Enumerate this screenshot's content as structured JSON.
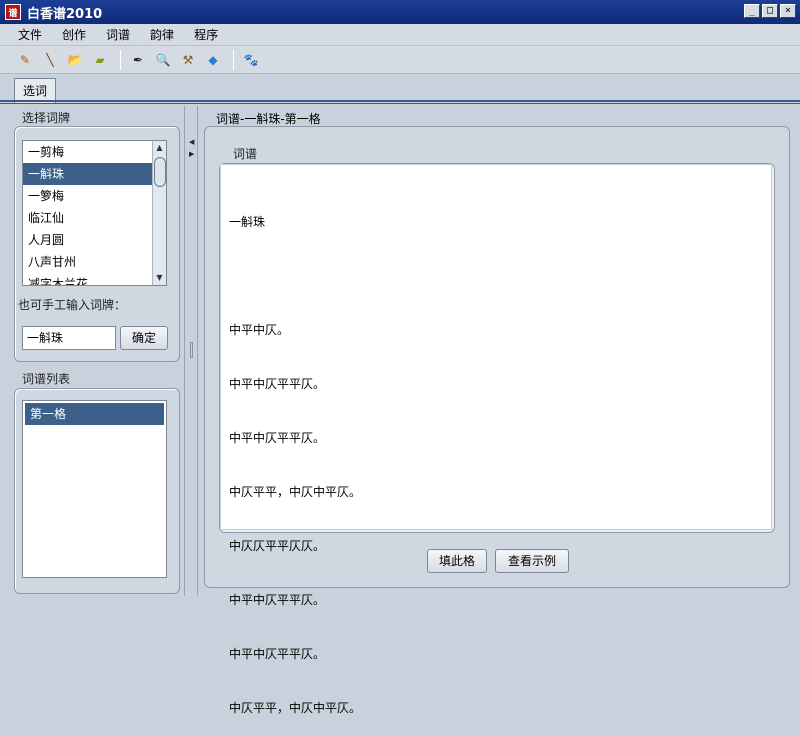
{
  "window": {
    "title": "白香谱2010",
    "app_icon_glyph": "谱",
    "controls": {
      "minimize": "_",
      "maximize": "□",
      "close": "×"
    }
  },
  "menu": [
    "文件",
    "创作",
    "词谱",
    "韵律",
    "程序"
  ],
  "toolbar": {
    "icons": [
      "pencil-icon",
      "brush-icon",
      "open-folder-icon",
      "eraser-icon",
      "pen-nib-icon",
      "magnifier-icon",
      "tools-icon",
      "tag-icon",
      "paw-icon"
    ],
    "glyphs": [
      "✎",
      "╲",
      "📂",
      "▰",
      "✒",
      "🔍",
      "⚒",
      "◆",
      "🐾"
    ]
  },
  "tabs": [
    {
      "label": "选词"
    }
  ],
  "left": {
    "select_label": "选择词牌",
    "cipai_list": [
      "一剪梅",
      "一斛珠",
      "一箩梅",
      "临江仙",
      "人月圆",
      "八声甘州",
      "减字木兰花"
    ],
    "selected_index": 1,
    "manual_label": "也可手工输入词牌：",
    "manual_value": "一斛珠",
    "confirm_label": "确定",
    "format_list_label": "词谱列表",
    "format_list": [
      "第一格"
    ]
  },
  "right": {
    "title": "词谱-一斛珠-第一格",
    "group_label": "词谱",
    "heading": "一斛珠",
    "lines": [
      "中平中仄。",
      "中平中仄平平仄。",
      "中平中仄平平仄。",
      "中仄平平，中仄中平仄。",
      "中仄仄平平仄仄。",
      "中平中仄平平仄。",
      "中平中仄平平仄。",
      "中仄平平，中仄中平仄。"
    ],
    "fill_button": "填此格",
    "example_button": "查看示例"
  },
  "colors": {
    "selection": "#3c6089",
    "titlebar": "#1d3f94",
    "background": "#c9d2dc"
  }
}
